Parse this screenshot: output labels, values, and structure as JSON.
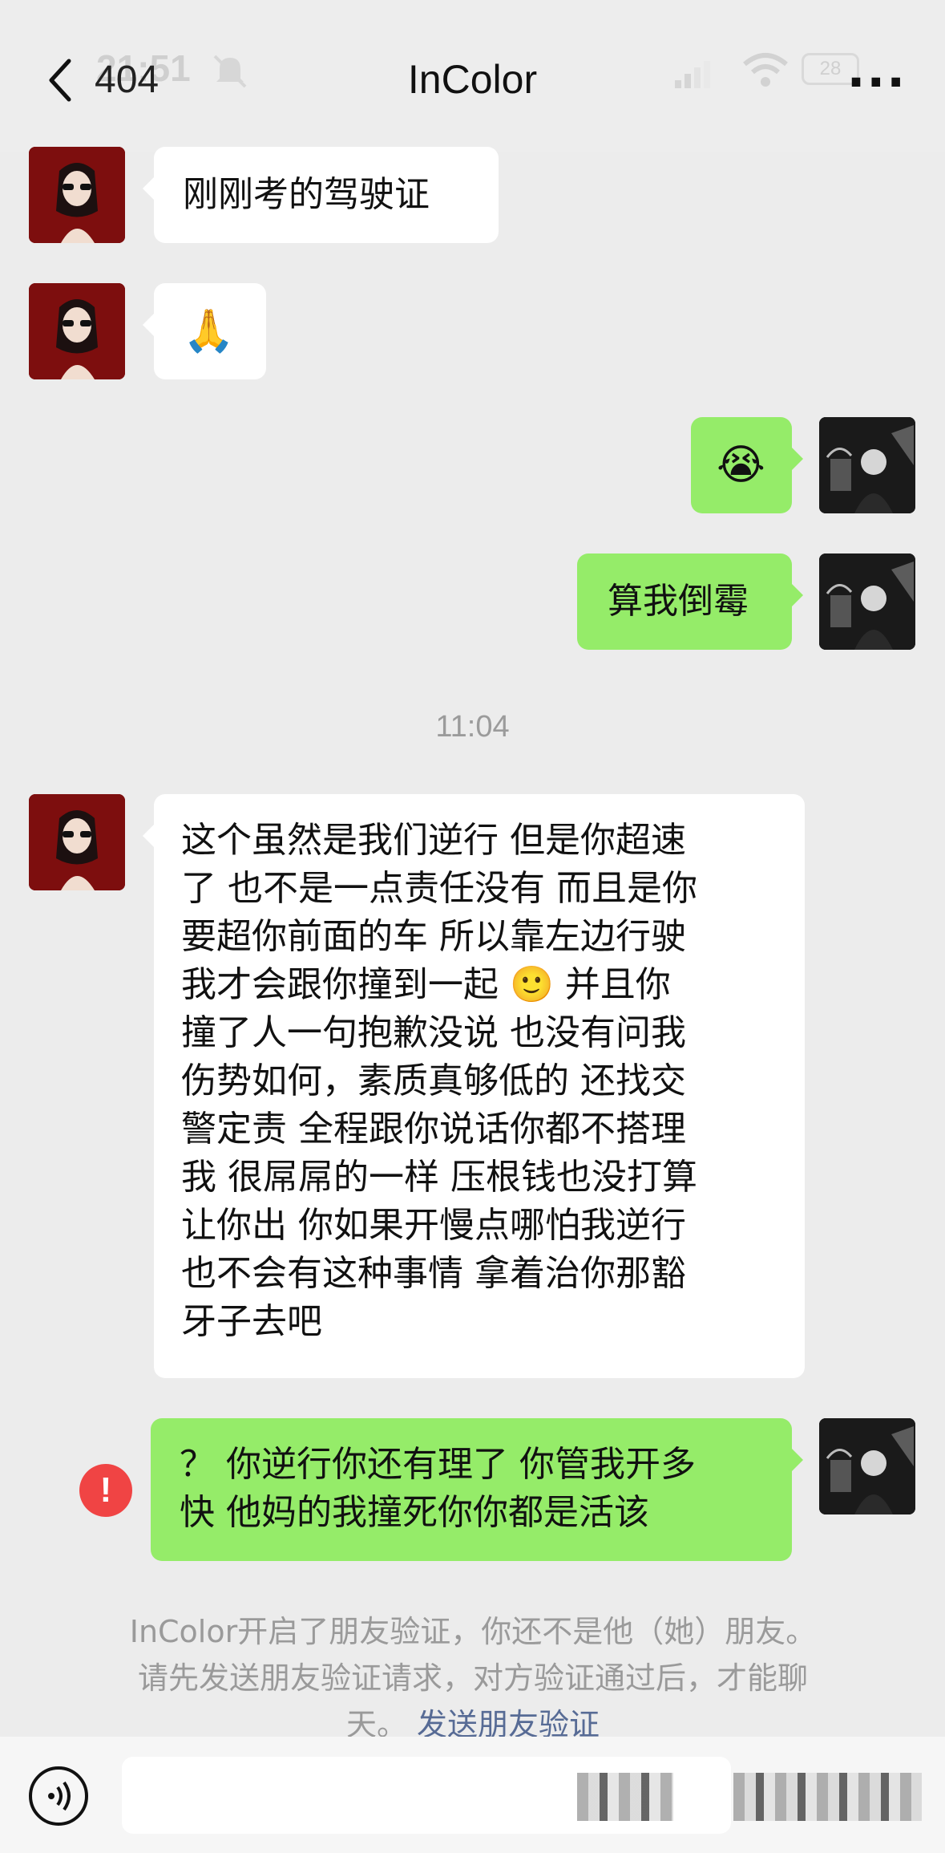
{
  "status_bar": {
    "time": "21:51",
    "battery": "28"
  },
  "header": {
    "back_count": "404",
    "title": "InColor",
    "more_label": "···"
  },
  "messages": [
    {
      "side": "left",
      "text": "刚刚考的驾驶证"
    },
    {
      "side": "left",
      "text": "🙏"
    },
    {
      "side": "right",
      "text": "😭"
    },
    {
      "side": "right",
      "text": "算我倒霉"
    },
    {
      "side": "left",
      "lines": [
        "这个虽然是我们逆行 但是你超速",
        "了 也不是一点责任没有 而且是你",
        "要超你前面的车 所以靠左边行驶",
        "我才会跟你撞到一起 🙂 并且你",
        "撞了人一句抱歉没说 也没有问我",
        "伤势如何，素质真够低的 还找交",
        "警定责 全程跟你说话你都不搭理",
        "我 很屌屌的一样 压根钱也没打算",
        "让你出 你如果开慢点哪怕我逆行",
        "也不会有这种事情 拿着治你那豁",
        "牙子去吧"
      ]
    },
    {
      "side": "right",
      "lines": [
        "？ 你逆行你还有理了 你管我开多",
        "快 他妈的我撞死你你都是活该"
      ],
      "failed": true,
      "fail_icon": "!"
    }
  ],
  "time_separator": "11:04",
  "system_message": {
    "line1": "InColor开启了朋友验证，你还不是他（她）朋友。",
    "line2": "请先发送朋友验证请求，对方验证通过后，才能聊",
    "line3_prefix": "天。",
    "link": "发送朋友验证"
  },
  "input_bar": {
    "voice_icon": "voice-icon",
    "input_value": ""
  }
}
